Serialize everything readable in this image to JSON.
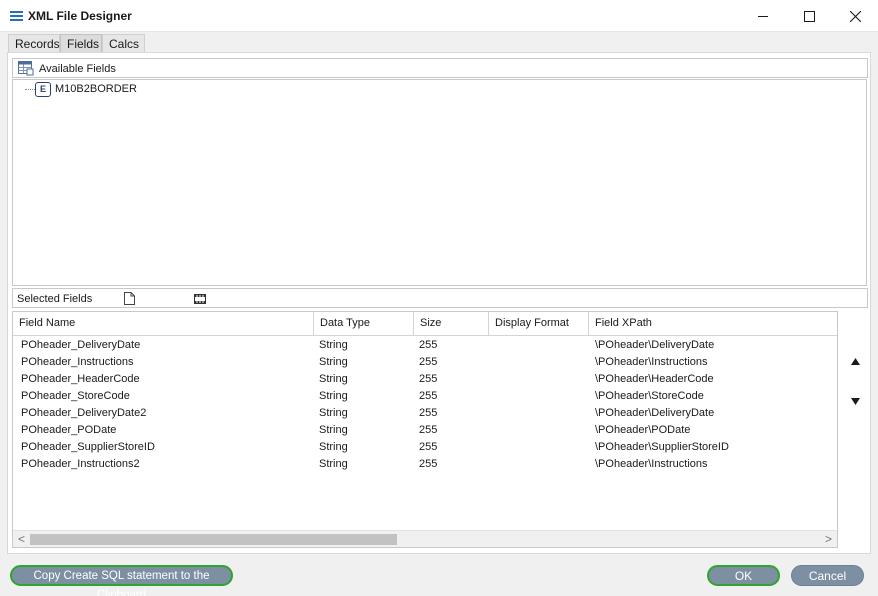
{
  "window": {
    "title": "XML File Designer",
    "icons": {
      "app": "list-icon",
      "minimize": "minimize-icon",
      "maximize": "maximize-icon",
      "close": "close-icon"
    }
  },
  "tabs": [
    {
      "label": "Records",
      "active": false
    },
    {
      "label": "Fields",
      "active": true
    },
    {
      "label": "Calcs",
      "active": false
    }
  ],
  "available_fields": {
    "header_label": "Available Fields",
    "header_icon": "table-icon",
    "tree": [
      {
        "label": "M10B2BORDER",
        "icon": "element-node-icon",
        "icon_text": "E"
      }
    ]
  },
  "selected_fields": {
    "header_label": "Selected Fields",
    "icons": [
      "new-document-icon",
      "film-strip-icon"
    ],
    "columns": [
      "Field Name",
      "Data Type",
      "Size",
      "Display Format",
      "Field XPath"
    ],
    "rows": [
      [
        "POheader_DeliveryDate",
        "String",
        "255",
        "",
        "\\POheader\\DeliveryDate"
      ],
      [
        "POheader_Instructions",
        "String",
        "255",
        "",
        "\\POheader\\Instructions"
      ],
      [
        "POheader_HeaderCode",
        "String",
        "255",
        "",
        "\\POheader\\HeaderCode"
      ],
      [
        "POheader_StoreCode",
        "String",
        "255",
        "",
        "\\POheader\\StoreCode"
      ],
      [
        "POheader_DeliveryDate2",
        "String",
        "255",
        "",
        "\\POheader\\DeliveryDate"
      ],
      [
        "POheader_PODate",
        "String",
        "255",
        "",
        "\\POheader\\PODate"
      ],
      [
        "POheader_SupplierStoreID",
        "String",
        "255",
        "",
        "\\POheader\\SupplierStoreID"
      ],
      [
        "POheader_Instructions2",
        "String",
        "255",
        "",
        "\\POheader\\Instructions"
      ]
    ],
    "scrollbar": {
      "left_arrow": "<",
      "right_arrow": ">"
    },
    "move_buttons": [
      "arrow-up-icon",
      "arrow-down-icon"
    ]
  },
  "buttons": {
    "copy_sql": "Copy Create SQL statement to the Clipboard",
    "ok": "OK",
    "cancel": "Cancel"
  },
  "colors": {
    "accent_border": "#2fa52b",
    "button_fill": "#7d8fa3",
    "title_icon": "#2a6fb5"
  }
}
